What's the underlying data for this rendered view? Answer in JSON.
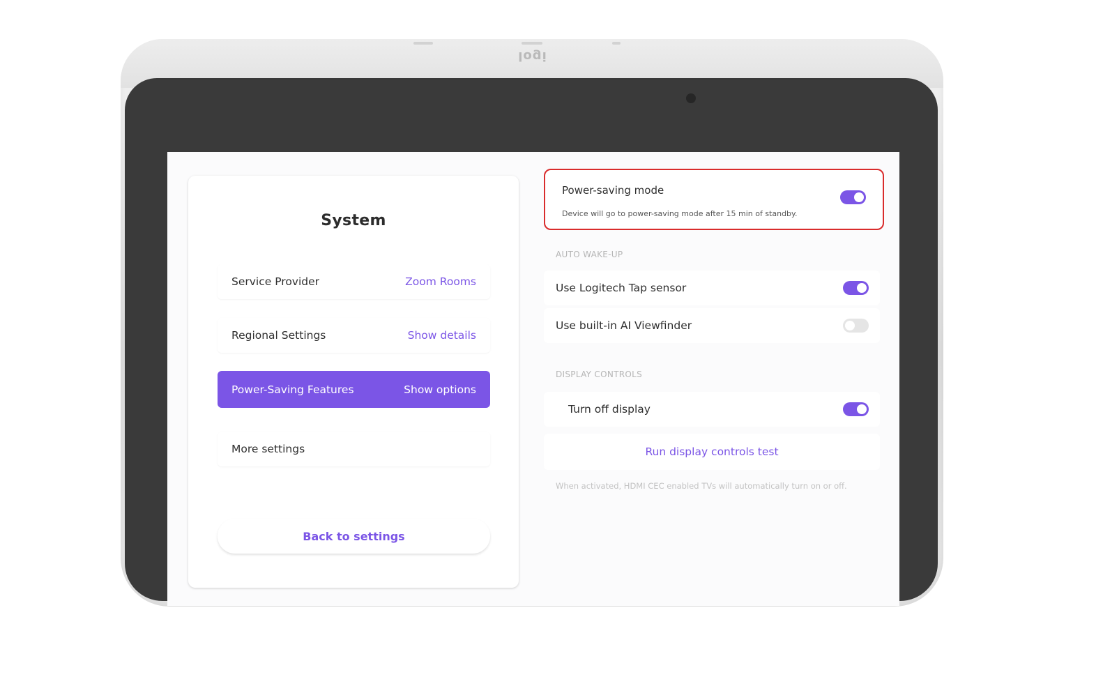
{
  "device": {
    "logo_text": "logi"
  },
  "left": {
    "title": "System",
    "rows": [
      {
        "label": "Service Provider",
        "value": "Zoom Rooms"
      },
      {
        "label": "Regional Settings",
        "value": "Show details"
      },
      {
        "label": "Power-Saving Features",
        "value": "Show options"
      },
      {
        "label": "More settings",
        "value": ""
      }
    ],
    "back_label": "Back to settings"
  },
  "right": {
    "power_saving": {
      "title": "Power-saving mode",
      "description": "Device will go to power-saving mode after 15 min of standby.",
      "enabled": true
    },
    "auto_wakeup": {
      "label": "AUTO WAKE-UP",
      "items": [
        {
          "label": "Use Logitech Tap sensor",
          "enabled": true
        },
        {
          "label": "Use built-in AI Viewfinder",
          "enabled": false
        }
      ]
    },
    "display_controls": {
      "label": "DISPLAY CONTROLS",
      "turn_off": {
        "label": "Turn off display",
        "enabled": true
      },
      "run_test_label": "Run display controls test",
      "footnote": "When activated, HDMI CEC enabled TVs will automatically turn on or off."
    }
  },
  "colors": {
    "accent": "#7b55e6",
    "highlight": "#d92c2c"
  }
}
